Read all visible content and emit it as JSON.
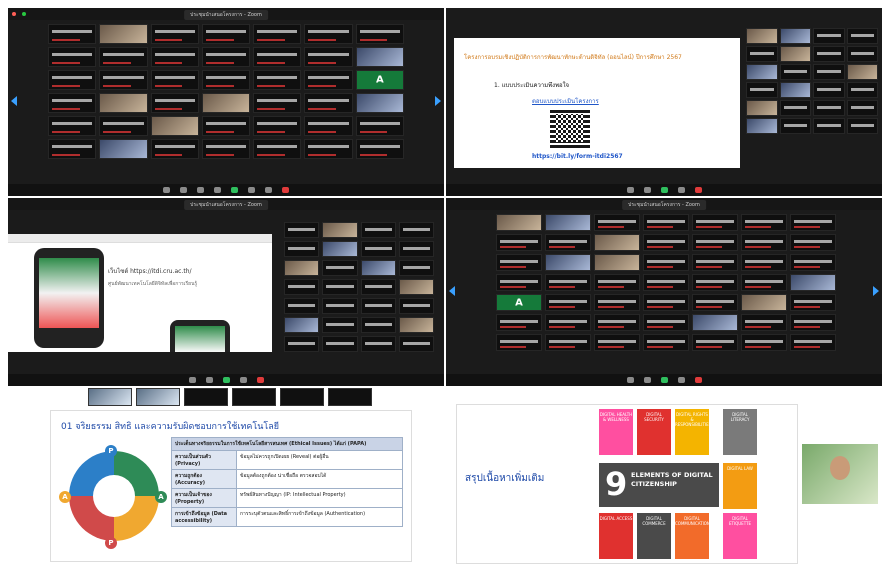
{
  "panels": [
    {
      "window_title": "ประชุมนำเสนอโครงการ - Zoom",
      "side_label": ""
    },
    {
      "slide": {
        "title": "โครงการอบรมเชิงปฏิบัติการการพัฒนาทักษะด้านดิจิทัล (ออนไลน์) ปีการศึกษา 2567",
        "bullet": "1.  แบบประเมินความพึงพอใจ",
        "link_label": "ตอบแบบประเมินโครงการ",
        "short_url": "https://bit.ly/form-itdi2567"
      }
    },
    {
      "window_title": "ประชุมนำเสนอโครงการ - Zoom",
      "site_title": "เว็บไซต์ https://itdi.cru.ac.th/",
      "site_desc": "ศูนย์พัฒนาเทคโนโลยีดิจิทัลเพื่อการเรียนรู้"
    },
    {
      "window_title": "ประชุมนำเสนอโครงการ - Zoom"
    },
    {
      "slide": {
        "title": "01 จริยธรรม สิทธิ และความรับผิดชอบการใช้เทคโนโลยี",
        "table_header": "ประเด็นทางจริยธรรมในการใช้เทคโนโลยีสารสนเทศ (Ethical Issues) ได้แก่ (PAPA)",
        "rows": [
          {
            "key": "ความเป็นส่วนตัว (Privacy)",
            "desc": "ข้อมูลไม่ควรถูกเปิดเผย (Reveal) ต่อผู้อื่น"
          },
          {
            "key": "ความถูกต้อง (Accuracy)",
            "desc": "ข้อมูลต้องถูกต้อง น่าเชื่อถือ ตรวจสอบได้"
          },
          {
            "key": "ความเป็นเจ้าของ (Property)",
            "desc": "ทรัพย์สินทางปัญญา (IP: Intellectual Property)"
          },
          {
            "key": "การเข้าถึงข้อมูล (Data accessibility)",
            "desc": "การระบุตัวตนและสิทธิ์การเข้าถึงข้อมูล (Authentication)"
          }
        ],
        "wheel_letters": [
          "P",
          "A",
          "P",
          "A"
        ]
      }
    },
    {
      "slide": {
        "title": "สรุปเนื้อหาเพิ่มเติม",
        "card_number": "9",
        "card_text": "ELEMENTS OF DIGITAL CITIZENSHIP",
        "tiles": [
          "DIGITAL HEALTH & WELLNESS",
          "DIGITAL SECURITY",
          "DIGITAL RIGHTS & RESPONSIBILITIES",
          "DIGITAL LITERACY",
          "DIGITAL LAW",
          "DIGITAL ACCESS",
          "DIGITAL COMMERCE",
          "DIGITAL COMMUNICATION",
          "DIGITAL ETIQUETTE"
        ]
      }
    }
  ],
  "colors": {
    "zoom_bg": "#1b1b1b",
    "accent_blue": "#1f4aa8",
    "link_blue": "#1f56c8",
    "orange": "#d17a1a"
  }
}
